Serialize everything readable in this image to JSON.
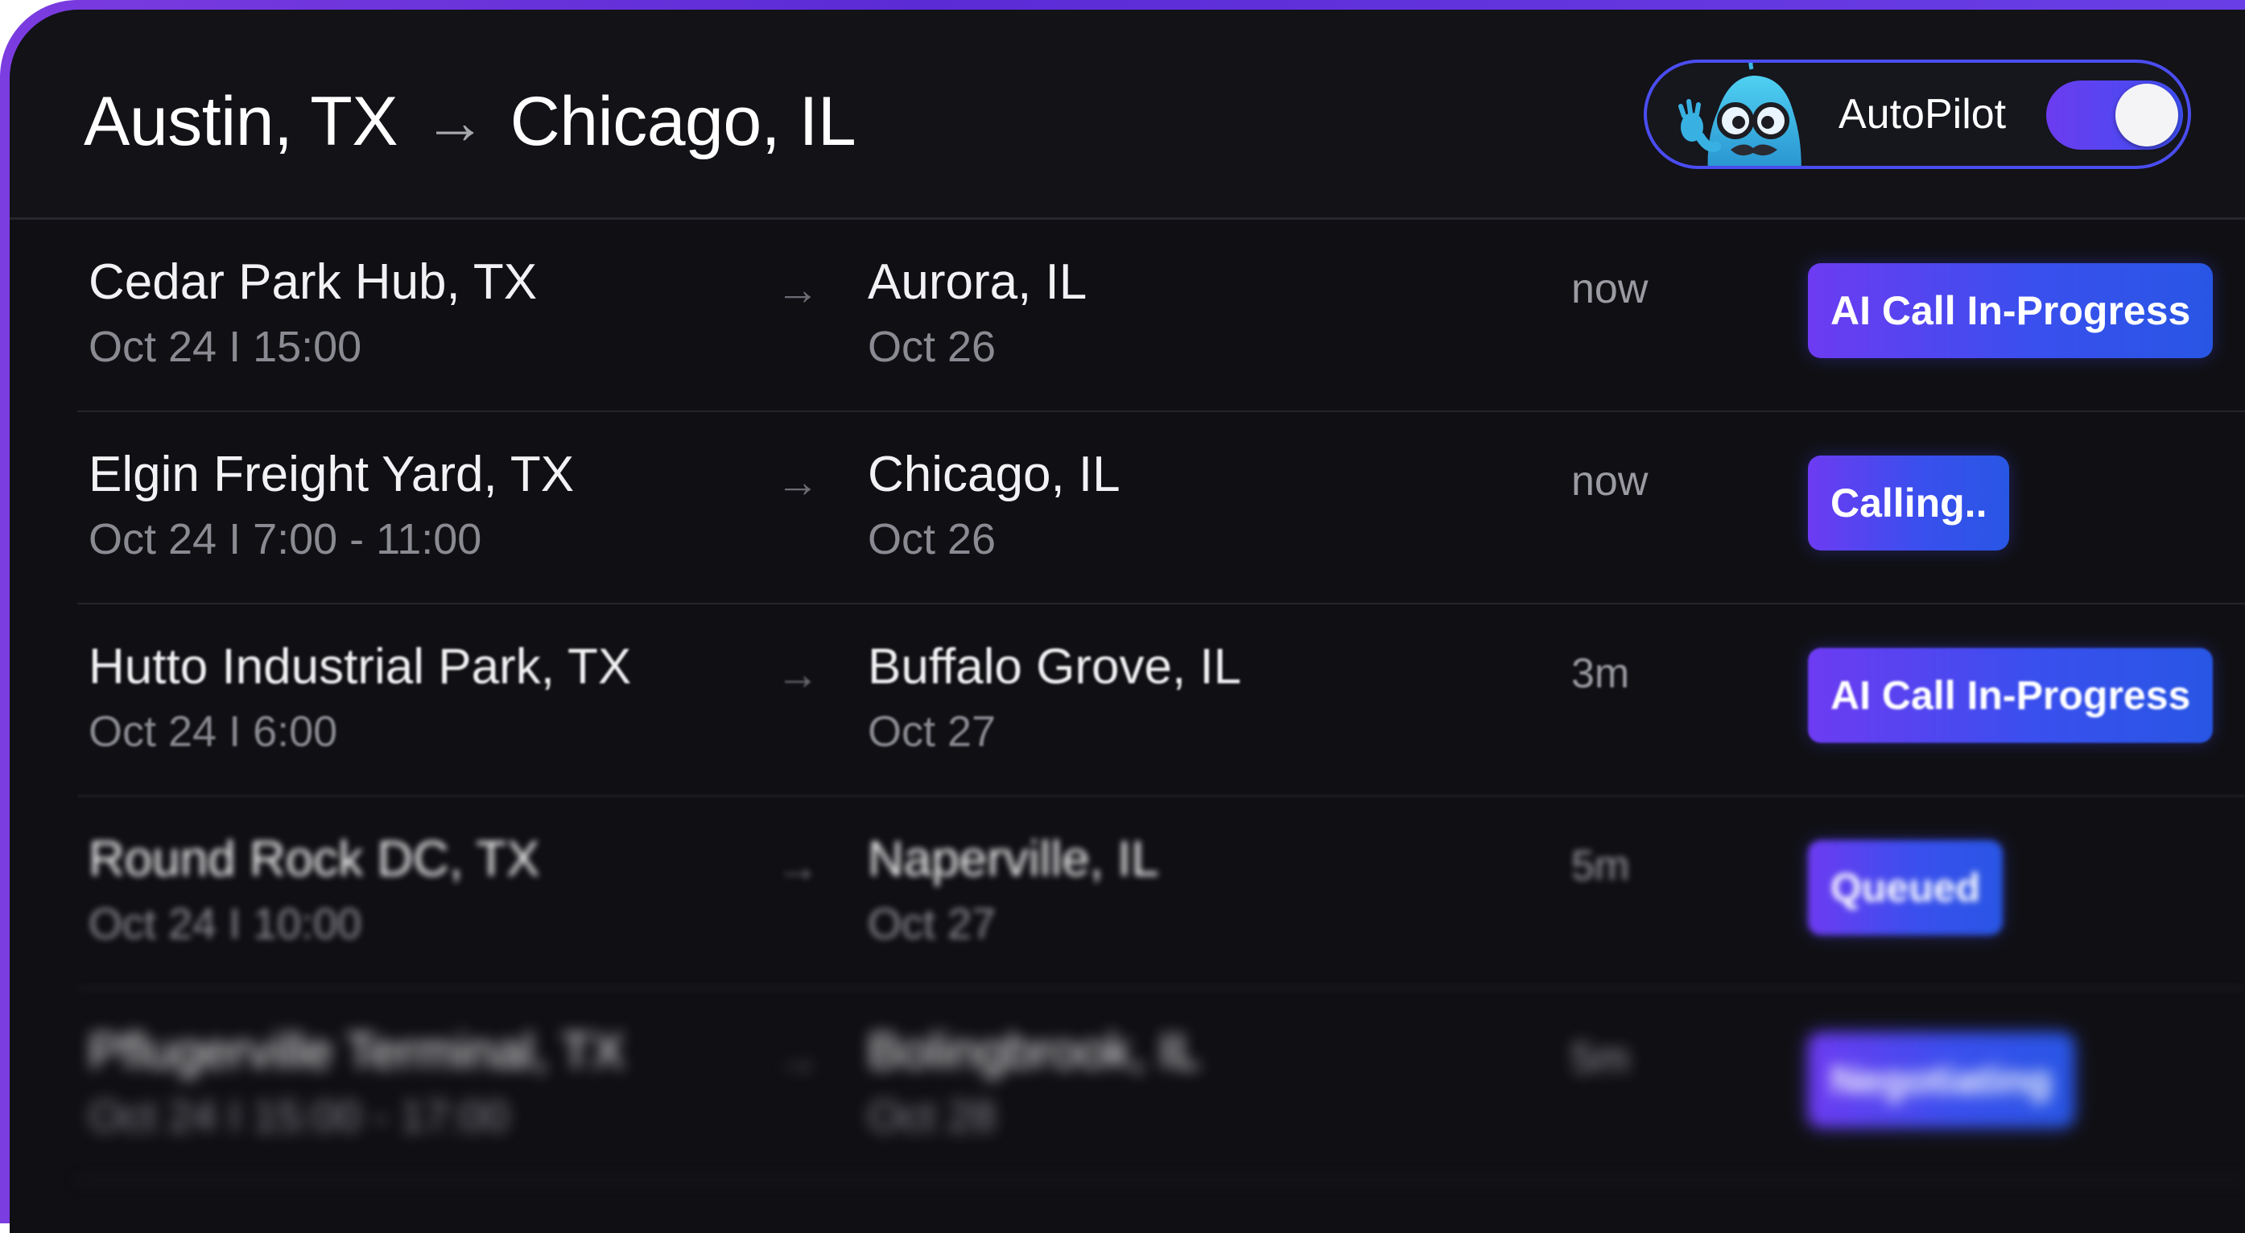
{
  "header": {
    "origin": "Austin, TX",
    "arrow": "→",
    "destination": "Chicago, IL"
  },
  "autopilot": {
    "label": "AutoPilot",
    "enabled": true,
    "mascot_icon": "mascot-avatar"
  },
  "colors": {
    "accent": "#4a4df0",
    "status_gradient_start": "#6d3bf2",
    "status_gradient_end": "#2856e4",
    "background": "#101014"
  },
  "loads": [
    {
      "origin": "Cedar Park Hub, TX",
      "origin_date": "Oct 24 I 15:00",
      "arrow": "→",
      "destination": "Aurora, IL",
      "destination_date": "Oct 26",
      "time": "now",
      "status": "AI Call In-Progress"
    },
    {
      "origin": "Elgin Freight Yard, TX",
      "origin_date": "Oct 24 I 7:00 - 11:00",
      "arrow": "→",
      "destination": "Chicago, IL",
      "destination_date": "Oct 26",
      "time": "now",
      "status": "Calling.."
    },
    {
      "origin": "Hutto Industrial Park, TX",
      "origin_date": "Oct 24 I 6:00",
      "arrow": "→",
      "destination": "Buffalo Grove, IL",
      "destination_date": "Oct 27",
      "time": "3m",
      "status": "AI Call In-Progress"
    },
    {
      "origin": "Round Rock DC, TX",
      "origin_date": "Oct 24 I 10:00",
      "arrow": "→",
      "destination": "Naperville, IL",
      "destination_date": "Oct 27",
      "time": "5m",
      "status": "Queued"
    },
    {
      "origin": "Pflugerville Terminal, TX",
      "origin_date": "Oct 24 I 15:00 - 17:00",
      "arrow": "→",
      "destination": "Bolingbrook, IL",
      "destination_date": "Oct 28",
      "time": "5m",
      "status": "Negotiating"
    }
  ]
}
